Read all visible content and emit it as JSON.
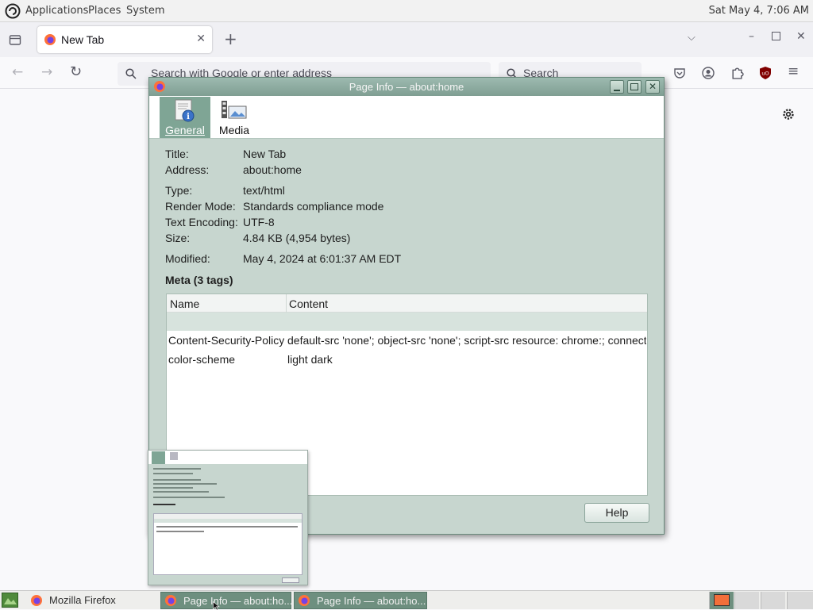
{
  "panel": {
    "menus": [
      "Applications",
      "Places",
      "System"
    ],
    "clock": "Sat May  4,  7:06 AM"
  },
  "browser": {
    "tab_title": "New Tab",
    "url_placeholder": "Search with Google or enter address",
    "search_placeholder": "Search"
  },
  "dialog": {
    "title": "Page Info — about:home",
    "panes": [
      "General",
      "Media"
    ],
    "general": {
      "title_label": "Title:",
      "title_value": "New Tab",
      "address_label": "Address:",
      "address_value": "about:home",
      "type_label": "Type:",
      "type_value": "text/html",
      "render_label": "Render Mode:",
      "render_value": "Standards compliance mode",
      "encoding_label": "Text Encoding:",
      "encoding_value": "UTF-8",
      "size_label": "Size:",
      "size_value": "4.84 KB (4,954 bytes)",
      "modified_label": "Modified:",
      "modified_value": "May 4, 2024 at 6:01:37 AM EDT"
    },
    "meta_heading": "Meta (3 tags)",
    "meta_columns": [
      "Name",
      "Content"
    ],
    "meta_rows": [
      {
        "name": "Content-Security-Policy",
        "content": "default-src 'none'; object-src 'none'; script-src resource: chrome:; connect-src..."
      },
      {
        "name": "color-scheme",
        "content": "light dark"
      }
    ],
    "help_label": "Help"
  },
  "taskbar": {
    "tasks": [
      "Mozilla Firefox",
      "Page Info — about:ho...",
      "Page Info — about:ho..."
    ]
  },
  "colors": {
    "dialog_bg": "#c7d6cf",
    "accent": "#7fa595",
    "firefox_orange": "#ff7139"
  }
}
